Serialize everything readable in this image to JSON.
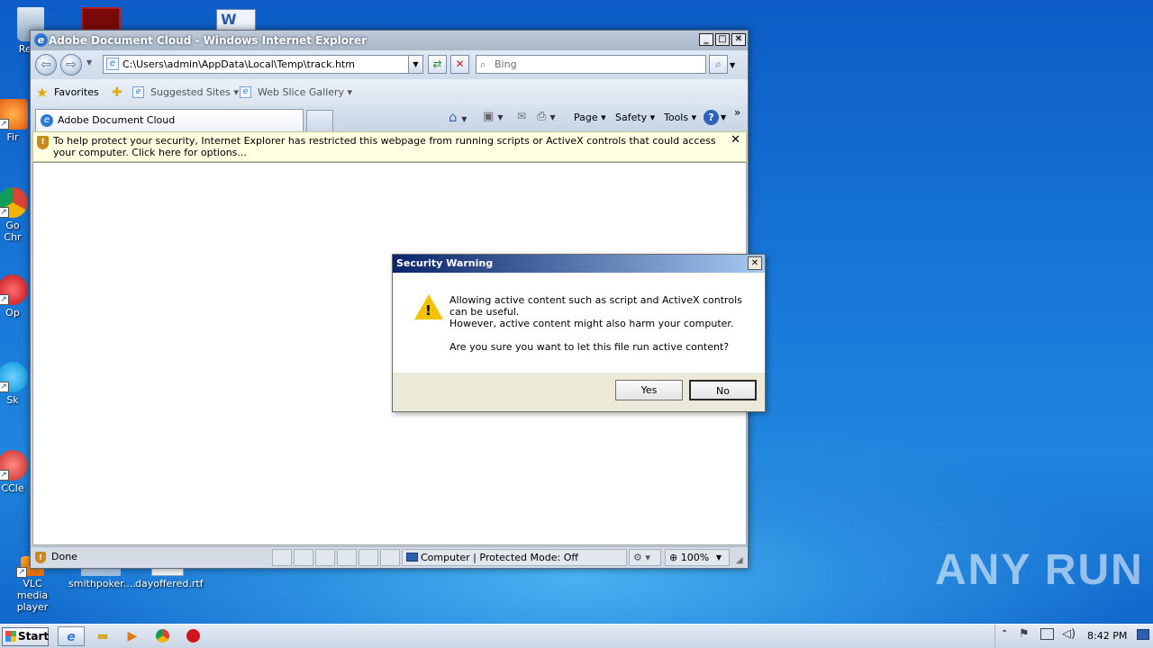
{
  "desktop": {
    "icons": [
      {
        "label": "Recy"
      },
      {
        "label": "Fir"
      },
      {
        "label": "Go\nChr"
      },
      {
        "label": "Op"
      },
      {
        "label": "Sk"
      },
      {
        "label": "CCle"
      },
      {
        "label": "VLC media player"
      },
      {
        "label": "smithpoker...."
      },
      {
        "label": "dayoffered.rtf"
      }
    ]
  },
  "ie": {
    "title": "Adobe Document Cloud - Windows Internet Explorer",
    "address": "C:\\Users\\admin\\AppData\\Local\\Temp\\track.htm",
    "search_placeholder": "Bing",
    "favorites_label": "Favorites",
    "suggested_sites": "Suggested Sites",
    "web_slice_gallery": "Web Slice Gallery",
    "tab_title": "Adobe Document Cloud",
    "commands": {
      "page": "Page",
      "safety": "Safety",
      "tools": "Tools"
    },
    "infobar_text": "To help protect your security, Internet Explorer has restricted this webpage from running scripts or ActiveX controls that could access your computer. Click here for options...",
    "status": {
      "done": "Done",
      "zone": "Computer | Protected Mode: Off",
      "zoom": "100%"
    }
  },
  "dialog": {
    "title": "Security Warning",
    "line1": "Allowing active content such as script and ActiveX controls can be useful.",
    "line2": "However, active content might also harm your computer.",
    "question": "Are you sure you want to let this file run active content?",
    "yes": "Yes",
    "no": "No"
  },
  "taskbar": {
    "start": "Start",
    "clock": "8:42 PM"
  },
  "watermark": "ANY RUN",
  "colors": {
    "desktop": "#1878d8",
    "dialog_title_start": "#0a246a",
    "infobar": "#ffffe1"
  }
}
